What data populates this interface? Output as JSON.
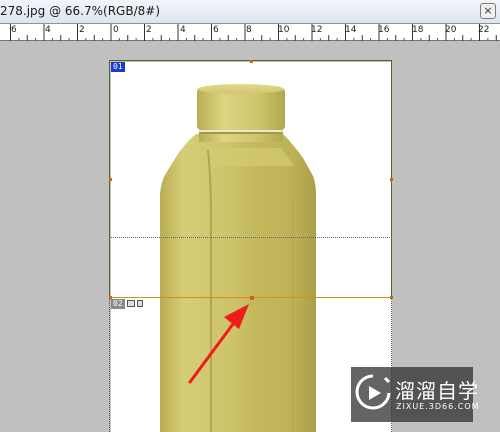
{
  "window": {
    "title": "278.jpg @ 66.7%(RGB/8#)",
    "close_glyph": "×"
  },
  "ruler": {
    "labels": [
      "6",
      "4",
      "2",
      "0",
      "2",
      "4",
      "6",
      "8",
      "10",
      "12",
      "14",
      "16",
      "18",
      "20",
      "22"
    ]
  },
  "slices": {
    "top_label": "01",
    "bottom_label": "02"
  },
  "watermark": {
    "name": "溜溜自学",
    "url": "ZIXUE.3D66.COM"
  },
  "colors": {
    "guide": "#e08a12",
    "arrow": "#ee1c1c",
    "bottle": "#c9c064",
    "active_slice": "#1a3ac8"
  },
  "icons": {
    "slice_image": "image-icon",
    "watermark_logo": "play-logo-icon"
  }
}
